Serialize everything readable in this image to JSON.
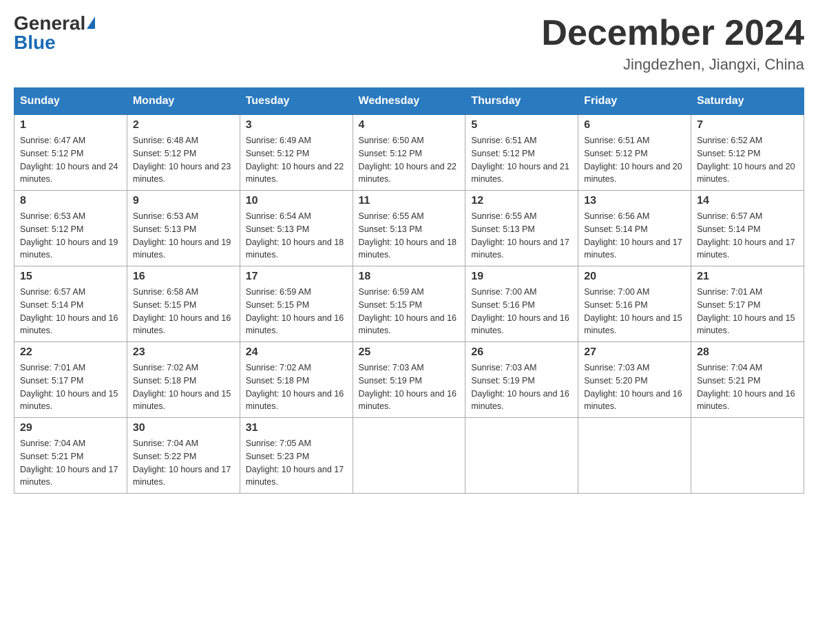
{
  "logo": {
    "general": "General",
    "blue": "Blue",
    "triangle": "▶"
  },
  "title": "December 2024",
  "location": "Jingdezhen, Jiangxi, China",
  "weekdays": [
    "Sunday",
    "Monday",
    "Tuesday",
    "Wednesday",
    "Thursday",
    "Friday",
    "Saturday"
  ],
  "weeks": [
    [
      {
        "day": "1",
        "sunrise": "6:47 AM",
        "sunset": "5:12 PM",
        "daylight": "10 hours and 24 minutes."
      },
      {
        "day": "2",
        "sunrise": "6:48 AM",
        "sunset": "5:12 PM",
        "daylight": "10 hours and 23 minutes."
      },
      {
        "day": "3",
        "sunrise": "6:49 AM",
        "sunset": "5:12 PM",
        "daylight": "10 hours and 22 minutes."
      },
      {
        "day": "4",
        "sunrise": "6:50 AM",
        "sunset": "5:12 PM",
        "daylight": "10 hours and 22 minutes."
      },
      {
        "day": "5",
        "sunrise": "6:51 AM",
        "sunset": "5:12 PM",
        "daylight": "10 hours and 21 minutes."
      },
      {
        "day": "6",
        "sunrise": "6:51 AM",
        "sunset": "5:12 PM",
        "daylight": "10 hours and 20 minutes."
      },
      {
        "day": "7",
        "sunrise": "6:52 AM",
        "sunset": "5:12 PM",
        "daylight": "10 hours and 20 minutes."
      }
    ],
    [
      {
        "day": "8",
        "sunrise": "6:53 AM",
        "sunset": "5:12 PM",
        "daylight": "10 hours and 19 minutes."
      },
      {
        "day": "9",
        "sunrise": "6:53 AM",
        "sunset": "5:13 PM",
        "daylight": "10 hours and 19 minutes."
      },
      {
        "day": "10",
        "sunrise": "6:54 AM",
        "sunset": "5:13 PM",
        "daylight": "10 hours and 18 minutes."
      },
      {
        "day": "11",
        "sunrise": "6:55 AM",
        "sunset": "5:13 PM",
        "daylight": "10 hours and 18 minutes."
      },
      {
        "day": "12",
        "sunrise": "6:55 AM",
        "sunset": "5:13 PM",
        "daylight": "10 hours and 17 minutes."
      },
      {
        "day": "13",
        "sunrise": "6:56 AM",
        "sunset": "5:14 PM",
        "daylight": "10 hours and 17 minutes."
      },
      {
        "day": "14",
        "sunrise": "6:57 AM",
        "sunset": "5:14 PM",
        "daylight": "10 hours and 17 minutes."
      }
    ],
    [
      {
        "day": "15",
        "sunrise": "6:57 AM",
        "sunset": "5:14 PM",
        "daylight": "10 hours and 16 minutes."
      },
      {
        "day": "16",
        "sunrise": "6:58 AM",
        "sunset": "5:15 PM",
        "daylight": "10 hours and 16 minutes."
      },
      {
        "day": "17",
        "sunrise": "6:59 AM",
        "sunset": "5:15 PM",
        "daylight": "10 hours and 16 minutes."
      },
      {
        "day": "18",
        "sunrise": "6:59 AM",
        "sunset": "5:15 PM",
        "daylight": "10 hours and 16 minutes."
      },
      {
        "day": "19",
        "sunrise": "7:00 AM",
        "sunset": "5:16 PM",
        "daylight": "10 hours and 16 minutes."
      },
      {
        "day": "20",
        "sunrise": "7:00 AM",
        "sunset": "5:16 PM",
        "daylight": "10 hours and 15 minutes."
      },
      {
        "day": "21",
        "sunrise": "7:01 AM",
        "sunset": "5:17 PM",
        "daylight": "10 hours and 15 minutes."
      }
    ],
    [
      {
        "day": "22",
        "sunrise": "7:01 AM",
        "sunset": "5:17 PM",
        "daylight": "10 hours and 15 minutes."
      },
      {
        "day": "23",
        "sunrise": "7:02 AM",
        "sunset": "5:18 PM",
        "daylight": "10 hours and 15 minutes."
      },
      {
        "day": "24",
        "sunrise": "7:02 AM",
        "sunset": "5:18 PM",
        "daylight": "10 hours and 16 minutes."
      },
      {
        "day": "25",
        "sunrise": "7:03 AM",
        "sunset": "5:19 PM",
        "daylight": "10 hours and 16 minutes."
      },
      {
        "day": "26",
        "sunrise": "7:03 AM",
        "sunset": "5:19 PM",
        "daylight": "10 hours and 16 minutes."
      },
      {
        "day": "27",
        "sunrise": "7:03 AM",
        "sunset": "5:20 PM",
        "daylight": "10 hours and 16 minutes."
      },
      {
        "day": "28",
        "sunrise": "7:04 AM",
        "sunset": "5:21 PM",
        "daylight": "10 hours and 16 minutes."
      }
    ],
    [
      {
        "day": "29",
        "sunrise": "7:04 AM",
        "sunset": "5:21 PM",
        "daylight": "10 hours and 17 minutes."
      },
      {
        "day": "30",
        "sunrise": "7:04 AM",
        "sunset": "5:22 PM",
        "daylight": "10 hours and 17 minutes."
      },
      {
        "day": "31",
        "sunrise": "7:05 AM",
        "sunset": "5:23 PM",
        "daylight": "10 hours and 17 minutes."
      },
      null,
      null,
      null,
      null
    ]
  ]
}
